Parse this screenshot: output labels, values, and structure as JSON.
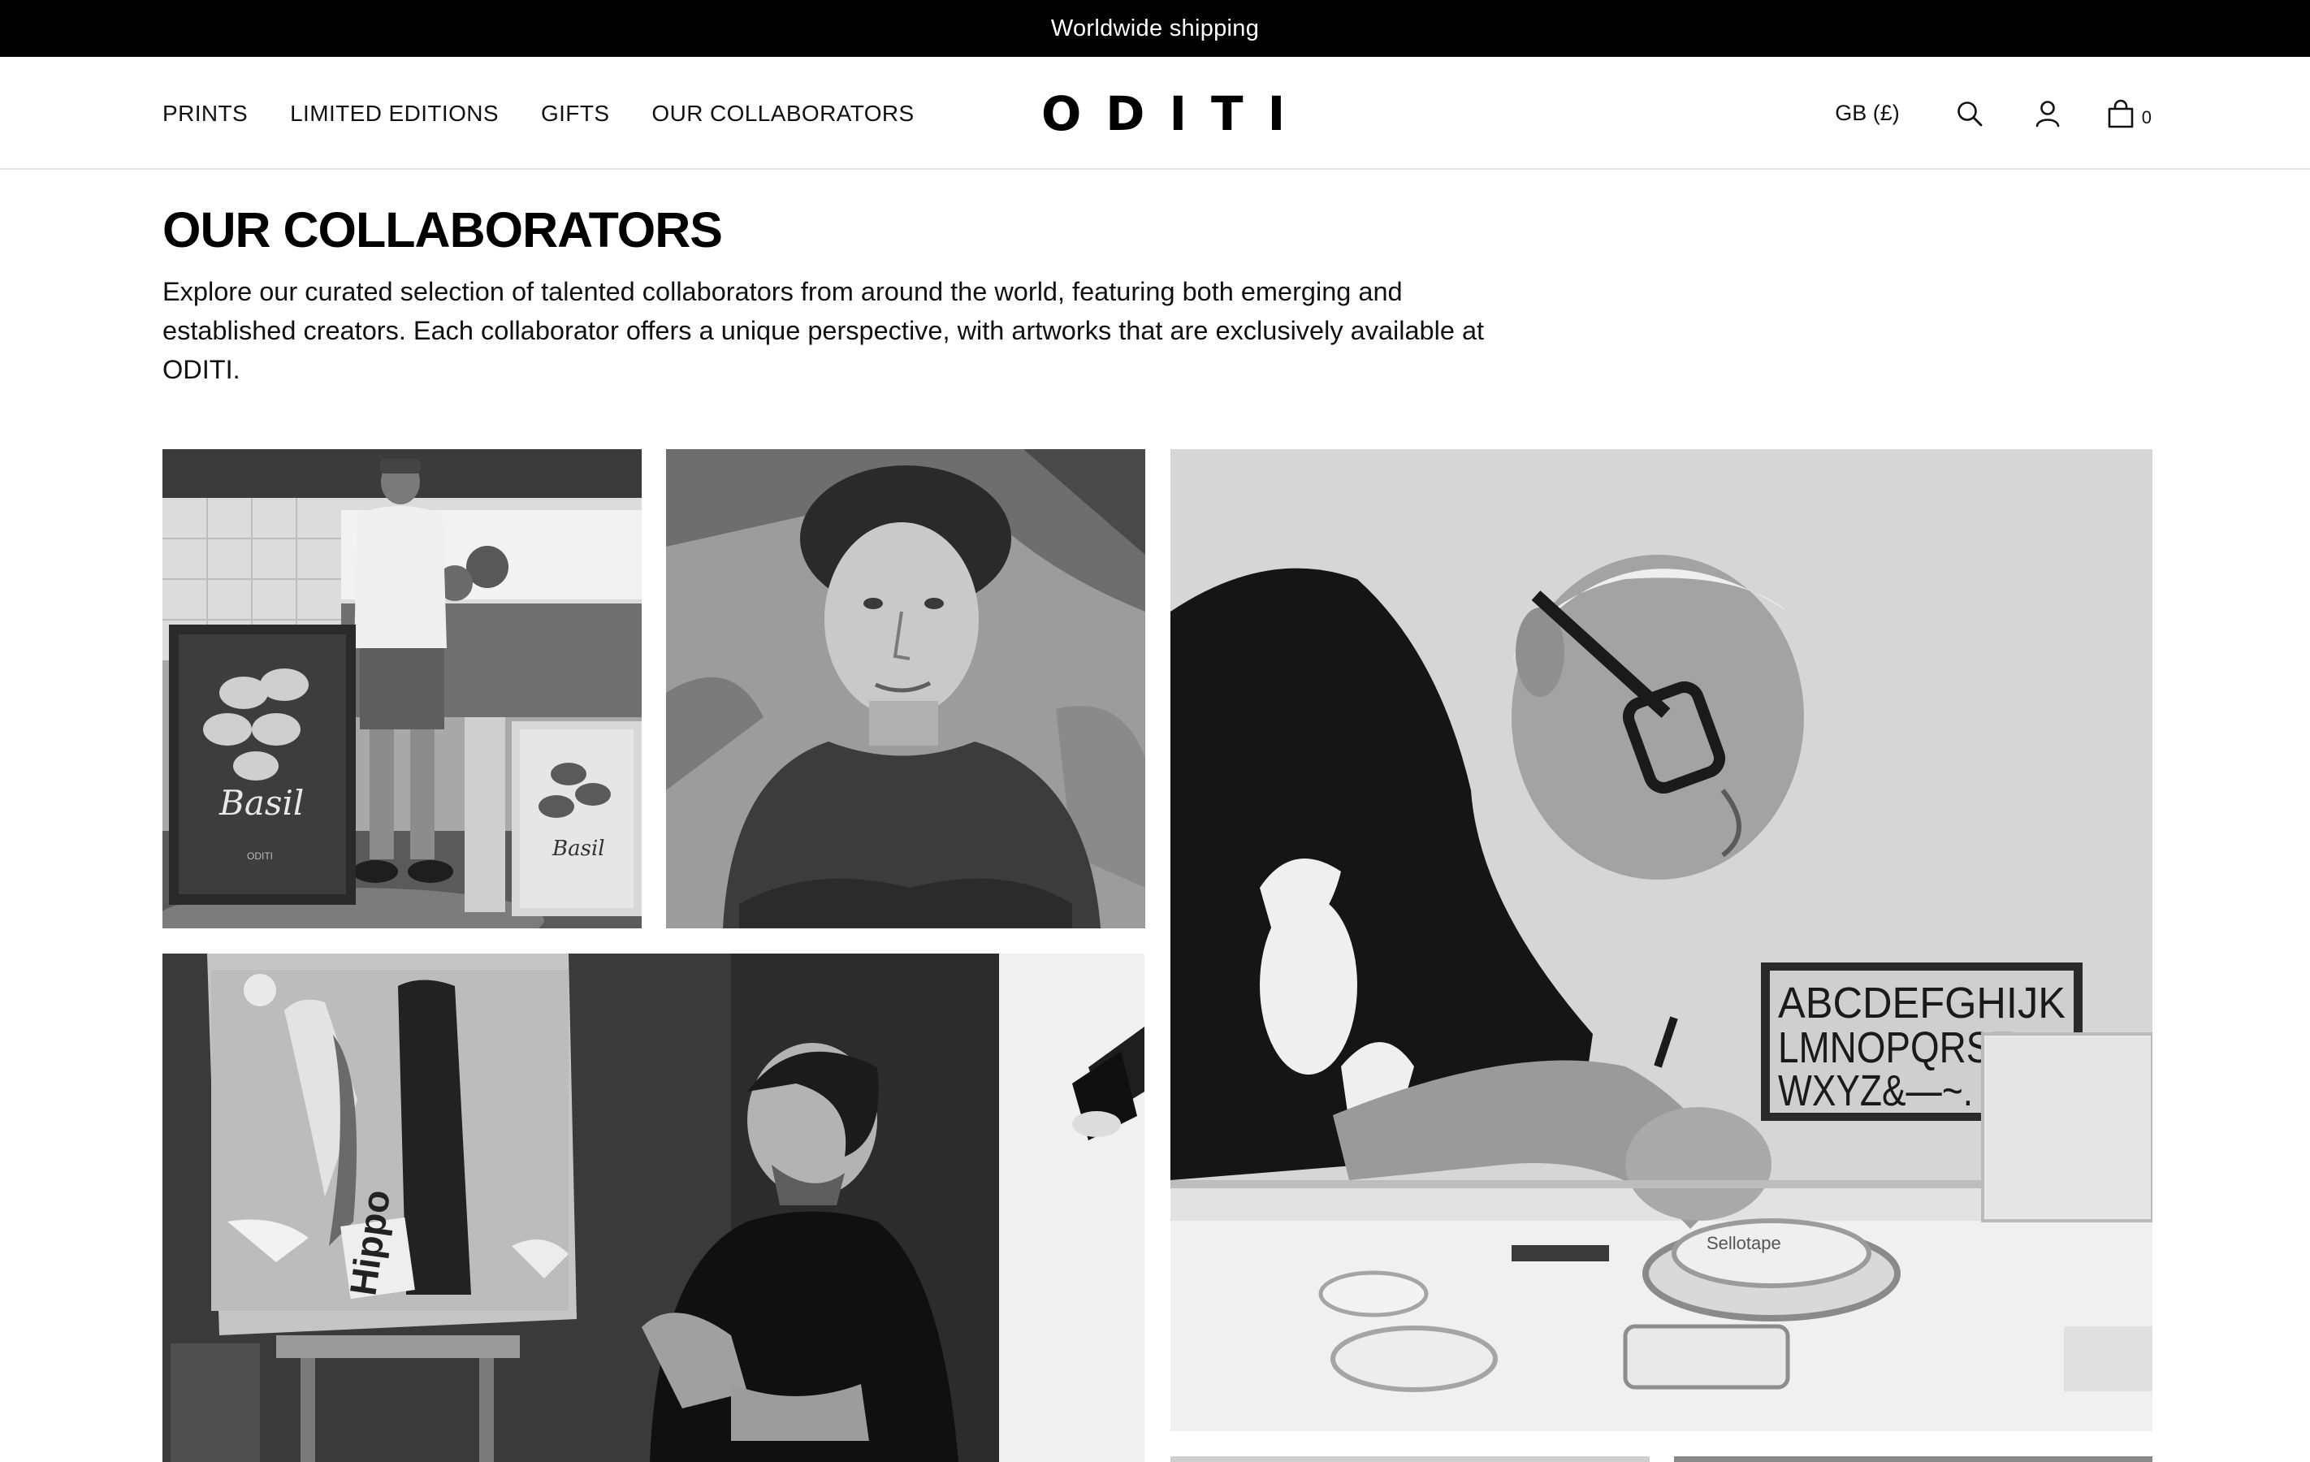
{
  "announcement": "Worldwide shipping",
  "nav": {
    "items": [
      {
        "label": "PRINTS"
      },
      {
        "label": "LIMITED EDITIONS"
      },
      {
        "label": "GIFTS"
      },
      {
        "label": "OUR COLLABORATORS"
      }
    ]
  },
  "logo": "ODITI",
  "header_tools": {
    "currency": "GB (£)",
    "search_icon": "search-icon",
    "account_icon": "user-icon",
    "cart_icon": "shopping-bag-icon",
    "cart_count": "0"
  },
  "page": {
    "title": "OUR COLLABORATORS",
    "intro": "Explore our curated selection of talented collaborators from around the world, featuring both emerging and established creators. Each collaborator offers a unique perspective, with artworks that are exclusively available at ODITI."
  },
  "artwork_text": {
    "poster_basil_1": "Basil",
    "poster_basil_2": "Basil",
    "poster_oditi": "ODITI",
    "lettering_line_1": "ABCDEFGHIJK",
    "lettering_line_2": "LMNOPQRSTUV",
    "lettering_line_3": "WXYZ&—~.",
    "tape_brand": "Sellotape",
    "canvas_word": "Hippo"
  },
  "colors": {
    "announcement_bg": "#000000",
    "announcement_text": "#ffffff",
    "text": "#111111",
    "divider": "#e4e4e4"
  }
}
